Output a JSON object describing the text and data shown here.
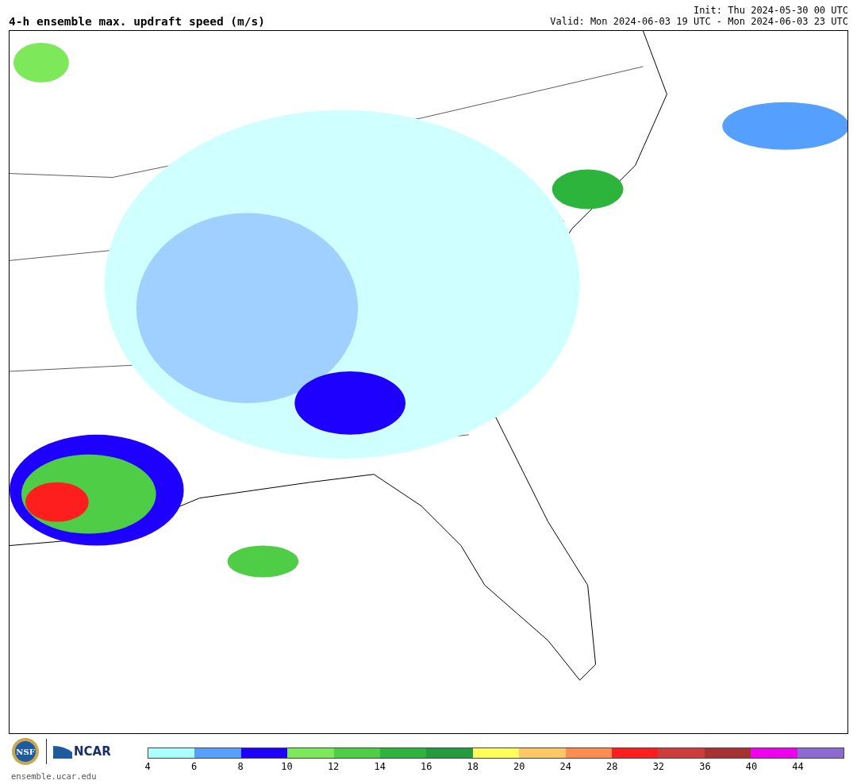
{
  "header": {
    "title": "4-h ensemble max. updraft speed (m/s)",
    "init": "Init: Thu 2024-05-30 00 UTC",
    "valid": "Valid: Mon 2024-06-03 19 UTC - Mon 2024-06-03 23 UTC"
  },
  "footer": {
    "nsf_logo": "NSF",
    "ncar_logo": "NCAR",
    "url": "ensemble.ucar.edu"
  },
  "colorbar": {
    "segments": [
      {
        "color": "#aaffff",
        "tick": "4"
      },
      {
        "color": "#55a0ff",
        "tick": "6"
      },
      {
        "color": "#1e00ff",
        "tick": "8"
      },
      {
        "color": "#7de85a",
        "tick": "10"
      },
      {
        "color": "#50cd46",
        "tick": "12"
      },
      {
        "color": "#2db43c",
        "tick": "14"
      },
      {
        "color": "#229c3e",
        "tick": "16"
      },
      {
        "color": "#ffff5a",
        "tick": "18"
      },
      {
        "color": "#ffc864",
        "tick": "20"
      },
      {
        "color": "#ff8c50",
        "tick": "24"
      },
      {
        "color": "#ff1e1e",
        "tick": "28"
      },
      {
        "color": "#d03c3c",
        "tick": "32"
      },
      {
        "color": "#a83232",
        "tick": "36"
      },
      {
        "color": "#ef00ef",
        "tick": "40"
      },
      {
        "color": "#8c6ad2",
        "tick": "44"
      }
    ]
  }
}
